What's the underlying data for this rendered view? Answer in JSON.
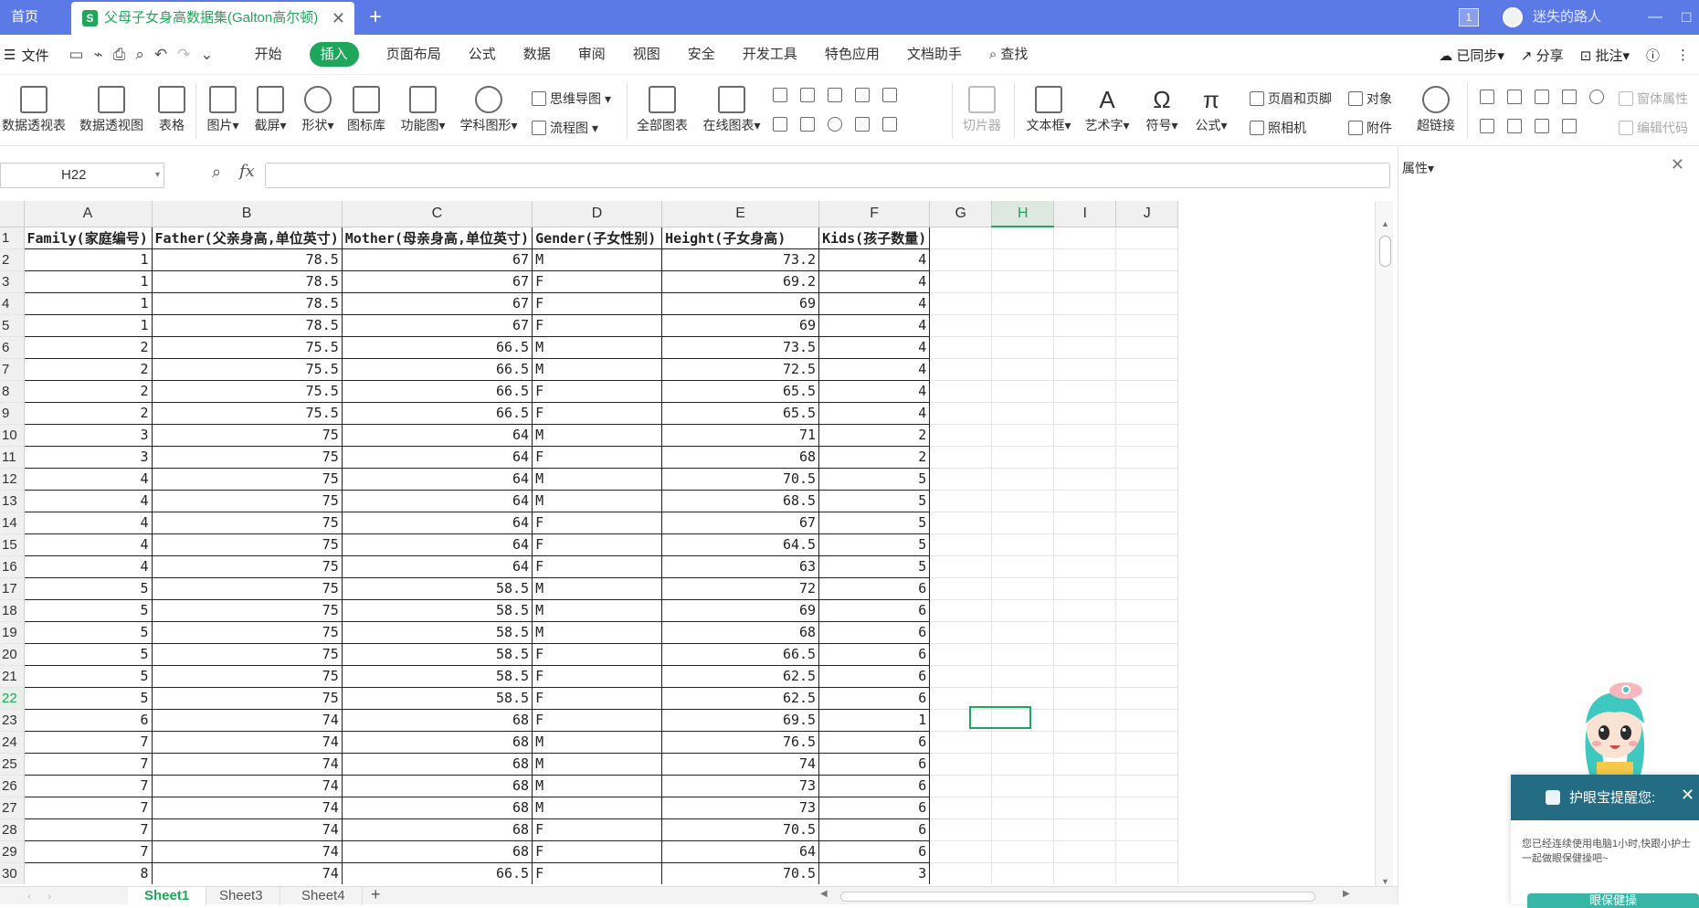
{
  "titlebar": {
    "home_tab": "首页",
    "doc_title": "父母子女身高数据集(Galton高尔顿)",
    "window_badge": "1",
    "username": "迷失的路人"
  },
  "menubar": {
    "file": "文件",
    "tabs": [
      "开始",
      "插入",
      "页面布局",
      "公式",
      "数据",
      "审阅",
      "视图",
      "安全",
      "开发工具",
      "特色应用",
      "文档助手",
      "查找"
    ],
    "active_tab": "插入",
    "sync": "已同步",
    "share": "分享",
    "comment": "批注"
  },
  "ribbon": {
    "pivot_table": "数据透视表",
    "pivot_chart": "数据透视图",
    "table": "表格",
    "picture": "图片",
    "screenshot": "截屏",
    "shapes": "形状",
    "icon_library": "图标库",
    "function_chart": "功能图",
    "subject_shapes": "学科图形",
    "mind_map": "思维导图",
    "flowchart": "流程图",
    "all_charts": "全部图表",
    "online_charts": "在线图表",
    "slicer": "切片器",
    "text_box": "文本框",
    "word_art": "艺术字",
    "symbol": "符号",
    "formula": "公式",
    "header_footer": "页眉和页脚",
    "camera": "照相机",
    "object": "对象",
    "attachment": "附件",
    "hyperlink": "超链接",
    "form_props": "窗体属性",
    "edit_code": "编辑代码"
  },
  "formula": {
    "cell_ref": "H22",
    "fx": "fx",
    "value": ""
  },
  "properties": {
    "title": "属性"
  },
  "sheet": {
    "columns": [
      "A",
      "B",
      "C",
      "D",
      "E",
      "F",
      "G",
      "H",
      "I",
      "J"
    ],
    "selected_col": "H",
    "selected_row": 22,
    "row_numbers": [
      "1",
      "2",
      "3",
      "4",
      "5",
      "6",
      "7",
      "8",
      "9",
      "10",
      "11",
      "12",
      "13",
      "14",
      "15",
      "16",
      "17",
      "18",
      "19",
      "20",
      "21",
      "22",
      "23",
      "24",
      "25",
      "26",
      "27",
      "28",
      "29",
      "30"
    ],
    "headers": [
      "Family(家庭编号)",
      "Father(父亲身高,单位英寸)",
      "Mother(母亲身高,单位英寸)",
      "Gender(子女性别)",
      "Height(子女身高)",
      "Kids(孩子数量)"
    ],
    "rows": [
      [
        "1",
        "78.5",
        "67",
        "M",
        "73.2",
        "4"
      ],
      [
        "1",
        "78.5",
        "67",
        "F",
        "69.2",
        "4"
      ],
      [
        "1",
        "78.5",
        "67",
        "F",
        "69",
        "4"
      ],
      [
        "1",
        "78.5",
        "67",
        "F",
        "69",
        "4"
      ],
      [
        "2",
        "75.5",
        "66.5",
        "M",
        "73.5",
        "4"
      ],
      [
        "2",
        "75.5",
        "66.5",
        "M",
        "72.5",
        "4"
      ],
      [
        "2",
        "75.5",
        "66.5",
        "F",
        "65.5",
        "4"
      ],
      [
        "2",
        "75.5",
        "66.5",
        "F",
        "65.5",
        "4"
      ],
      [
        "3",
        "75",
        "64",
        "M",
        "71",
        "2"
      ],
      [
        "3",
        "75",
        "64",
        "F",
        "68",
        "2"
      ],
      [
        "4",
        "75",
        "64",
        "M",
        "70.5",
        "5"
      ],
      [
        "4",
        "75",
        "64",
        "M",
        "68.5",
        "5"
      ],
      [
        "4",
        "75",
        "64",
        "F",
        "67",
        "5"
      ],
      [
        "4",
        "75",
        "64",
        "F",
        "64.5",
        "5"
      ],
      [
        "4",
        "75",
        "64",
        "F",
        "63",
        "5"
      ],
      [
        "5",
        "75",
        "58.5",
        "M",
        "72",
        "6"
      ],
      [
        "5",
        "75",
        "58.5",
        "M",
        "69",
        "6"
      ],
      [
        "5",
        "75",
        "58.5",
        "M",
        "68",
        "6"
      ],
      [
        "5",
        "75",
        "58.5",
        "F",
        "66.5",
        "6"
      ],
      [
        "5",
        "75",
        "58.5",
        "F",
        "62.5",
        "6"
      ],
      [
        "5",
        "75",
        "58.5",
        "F",
        "62.5",
        "6"
      ],
      [
        "6",
        "74",
        "68",
        "F",
        "69.5",
        "1"
      ],
      [
        "7",
        "74",
        "68",
        "M",
        "76.5",
        "6"
      ],
      [
        "7",
        "74",
        "68",
        "M",
        "74",
        "6"
      ],
      [
        "7",
        "74",
        "68",
        "M",
        "73",
        "6"
      ],
      [
        "7",
        "74",
        "68",
        "M",
        "73",
        "6"
      ],
      [
        "7",
        "74",
        "68",
        "F",
        "70.5",
        "6"
      ],
      [
        "7",
        "74",
        "68",
        "F",
        "64",
        "6"
      ],
      [
        "8",
        "74",
        "66.5",
        "F",
        "70.5",
        "3"
      ]
    ]
  },
  "sheet_tabs": [
    "Sheet1",
    "Sheet3",
    "Sheet4"
  ],
  "active_sheet": "Sheet1",
  "eyecare": {
    "title": "护眼宝提醒您:",
    "message": "您已经连续使用电脑1小时,快跟小护士一起做眼保健操吧~",
    "button": "眼保健操"
  },
  "colors": {
    "accent": "#20a65a",
    "titlebar": "#5b7ae6",
    "eyecare_header": "#246c83"
  }
}
